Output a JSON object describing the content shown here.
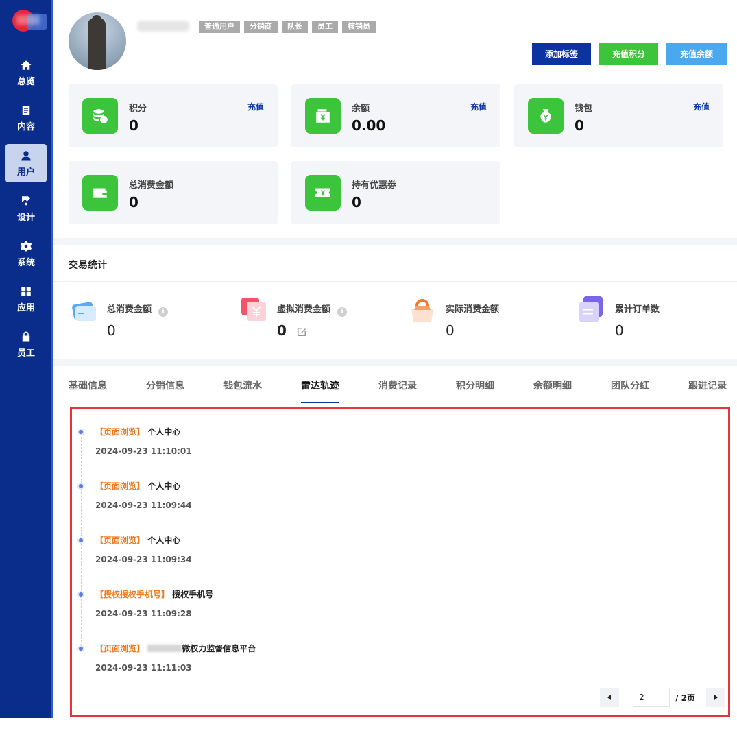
{
  "sidebar": {
    "items": [
      {
        "label": "总览",
        "icon": "home-icon"
      },
      {
        "label": "内容",
        "icon": "document-icon"
      },
      {
        "label": "用户",
        "icon": "user-icon"
      },
      {
        "label": "设计",
        "icon": "brush-icon"
      },
      {
        "label": "系统",
        "icon": "gear-icon"
      },
      {
        "label": "应用",
        "icon": "grid-icon"
      },
      {
        "label": "员工",
        "icon": "lock-icon"
      }
    ],
    "active_index": 2
  },
  "profile": {
    "tags": [
      "普通用户",
      "分销商",
      "队长",
      "员工",
      "核销员"
    ]
  },
  "actions": {
    "add_tag": "添加标签",
    "recharge_points": "充值积分",
    "recharge_balance": "充值余额"
  },
  "cards": [
    {
      "label": "积分",
      "value": "0",
      "link": "充值",
      "icon": "coins-icon"
    },
    {
      "label": "余额",
      "value": "0.00",
      "link": "充值",
      "icon": "wallet-yuan-icon"
    },
    {
      "label": "钱包",
      "value": "0",
      "link": "充值",
      "icon": "money-bag-icon"
    },
    {
      "label": "总消费金额",
      "value": "0",
      "icon": "wallet-icon"
    },
    {
      "label": "持有优惠劵",
      "value": "0",
      "icon": "coupon-icon"
    }
  ],
  "stats": {
    "title": "交易统计",
    "items": [
      {
        "label": "总消费金额",
        "value": "0"
      },
      {
        "label": "虚拟消费金额",
        "value": "0"
      },
      {
        "label": "实际消费金额",
        "value": "0"
      },
      {
        "label": "累计订单数",
        "value": "0"
      }
    ],
    "info_glyph": "i"
  },
  "tabs": [
    "基础信息",
    "分销信息",
    "钱包流水",
    "雷达轨迹",
    "消费记录",
    "积分明细",
    "余额明细",
    "团队分红",
    "跟进记录"
  ],
  "active_tab": 3,
  "timeline": [
    {
      "tag": "【页面浏览】",
      "title": "个人中心",
      "time": "2024-09-23 11:10:01"
    },
    {
      "tag": "【页面浏览】",
      "title": "个人中心",
      "time": "2024-09-23 11:09:44"
    },
    {
      "tag": "【页面浏览】",
      "title": "个人中心",
      "time": "2024-09-23 11:09:34"
    },
    {
      "tag": "【授权授权手机号】",
      "title": "授权手机号",
      "time": "2024-09-23 11:09:28"
    },
    {
      "tag": "【页面浏览】",
      "title": "微权力监督信息平台",
      "time": "2024-09-23 11:11:03"
    }
  ],
  "pager": {
    "current": "2",
    "total_label": "/ 2页"
  },
  "colors": {
    "sidebar": "#0a2c8a",
    "accent_blue": "#0c34a0",
    "green": "#3cc43c",
    "sky": "#4aa8ee",
    "highlight_border": "#e8333a",
    "timeline_tag": "#f07b22"
  }
}
